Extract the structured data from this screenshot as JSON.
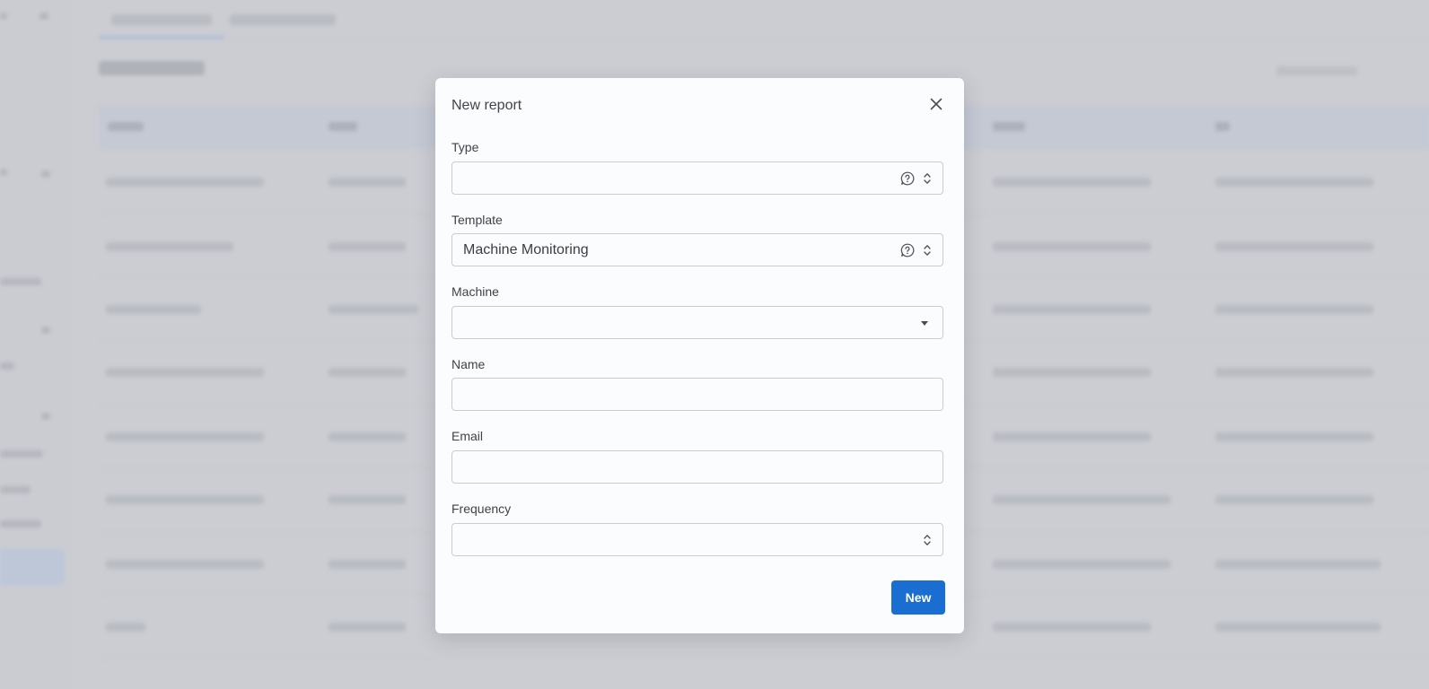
{
  "modal": {
    "title": "New report",
    "fields": {
      "type": {
        "label": "Type",
        "value": ""
      },
      "template": {
        "label": "Template",
        "value": "Machine Monitoring"
      },
      "machine": {
        "label": "Machine",
        "value": ""
      },
      "name": {
        "label": "Name",
        "value": ""
      },
      "email": {
        "label": "Email",
        "value": ""
      },
      "frequency": {
        "label": "Frequency",
        "value": ""
      }
    },
    "submit_label": "New"
  },
  "colors": {
    "accent": "#1a6ed2",
    "backdrop": "#cdcfd4",
    "modal_bg": "#fbfcfd"
  },
  "icons": {
    "close": "close-icon",
    "help": "help-circle-icon",
    "updown": "updown-chevrons-icon",
    "caret": "caret-down-icon"
  }
}
